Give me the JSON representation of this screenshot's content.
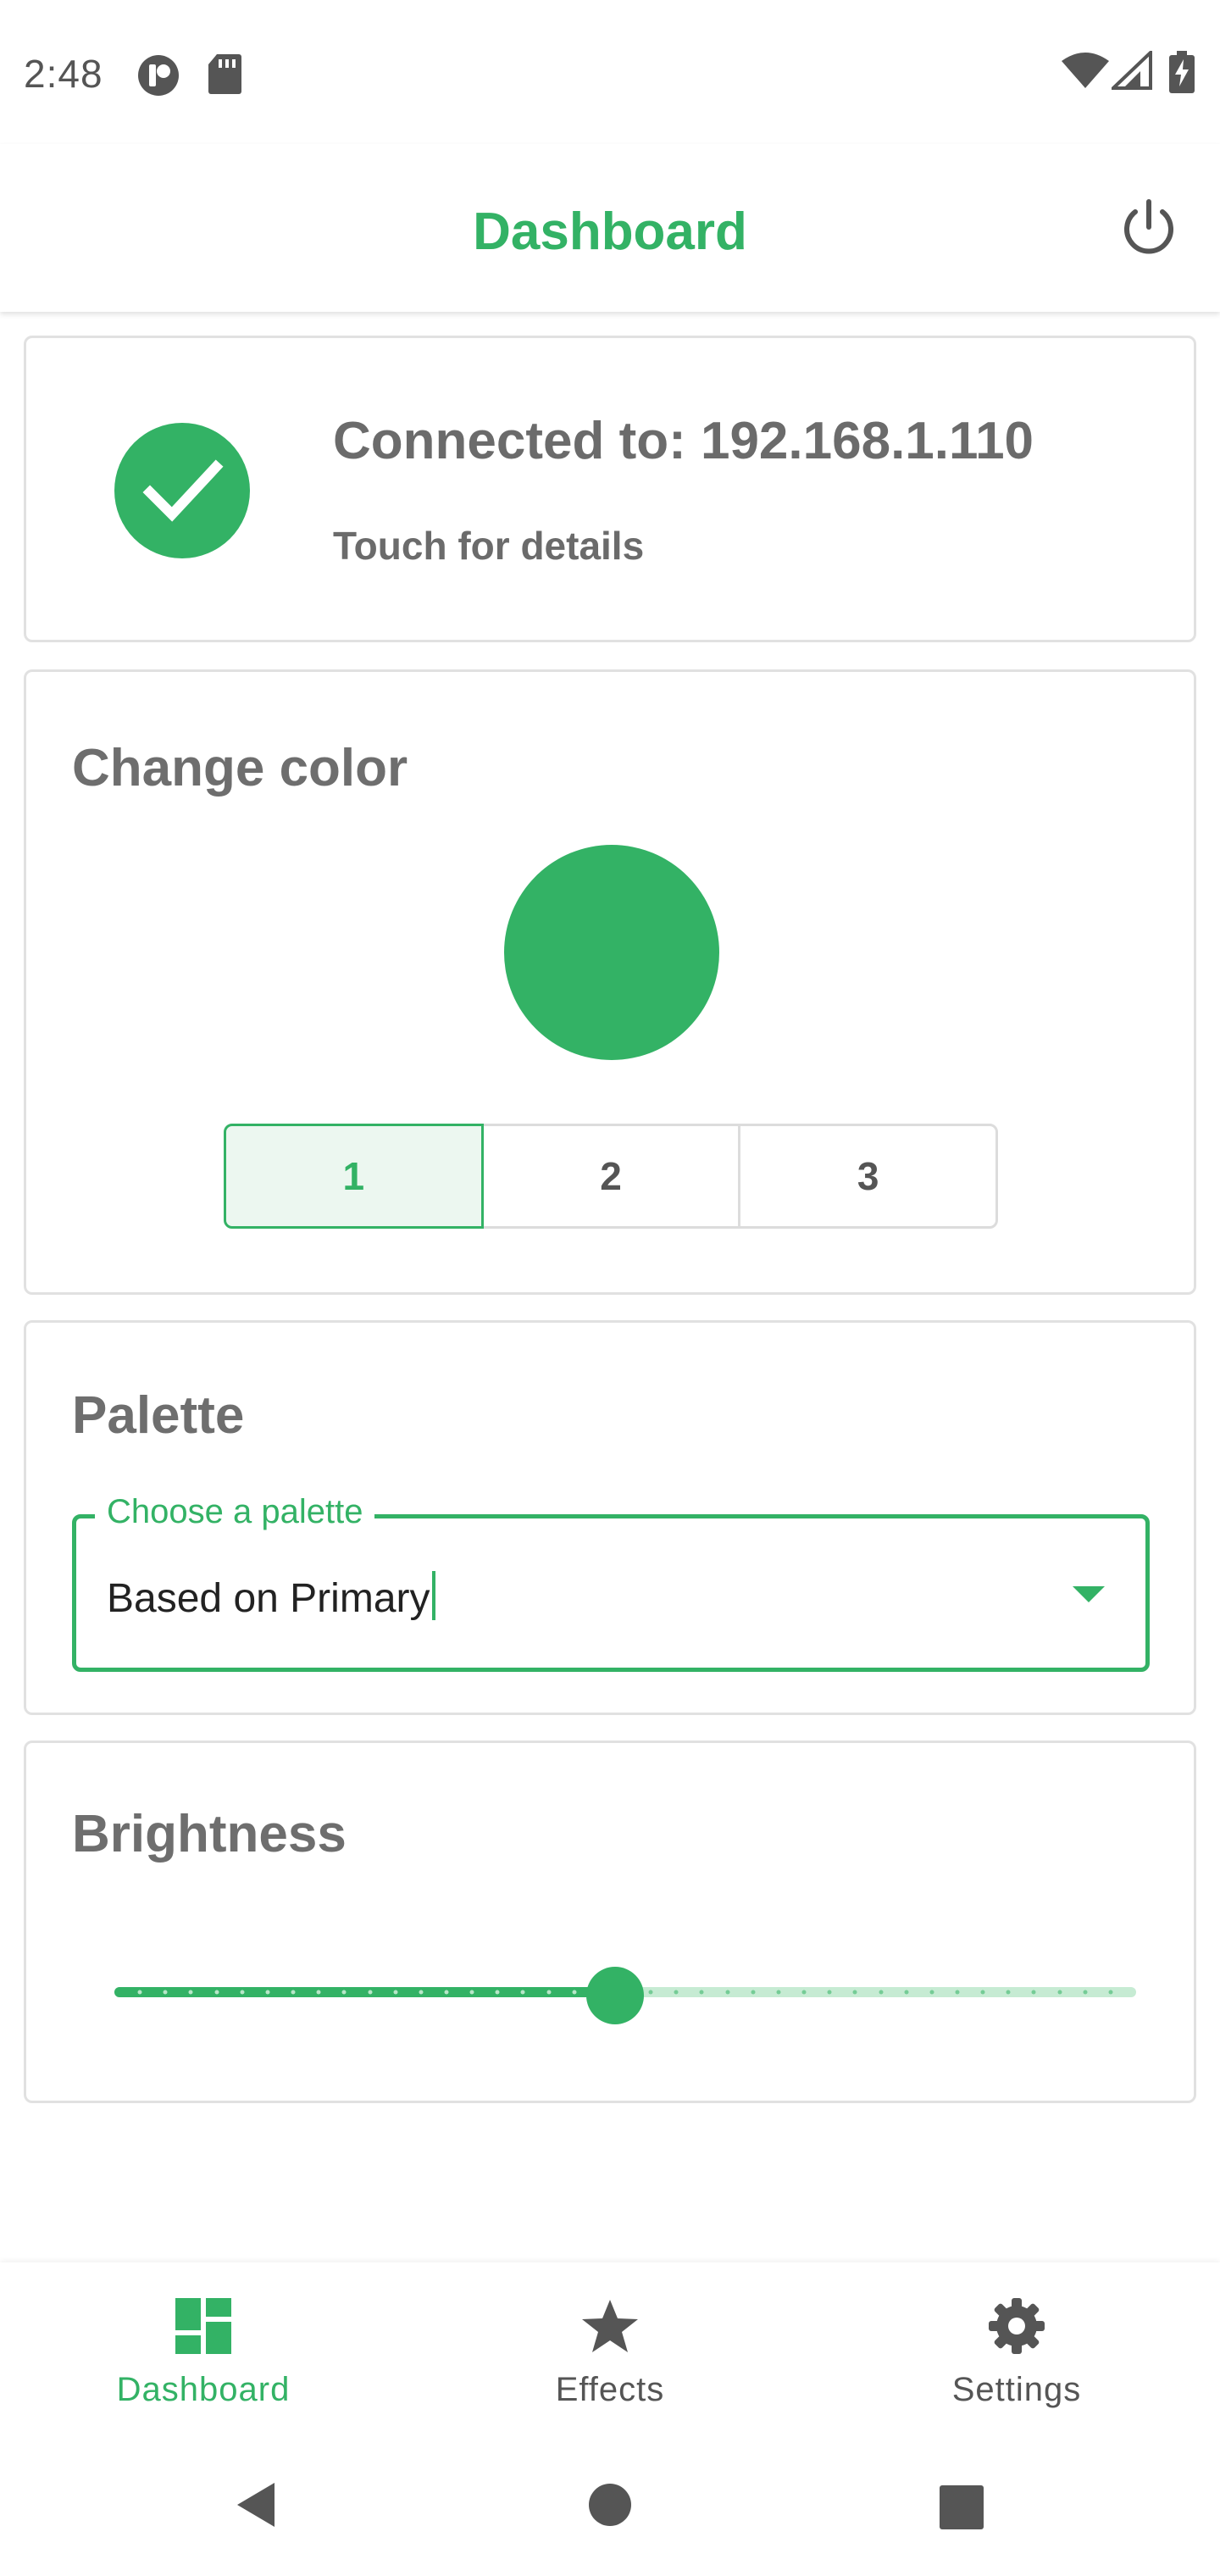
{
  "status_bar": {
    "time": "2:48",
    "left_icons": [
      "app-notification-icon",
      "sd-card-icon"
    ],
    "right_icons": [
      "wifi-icon",
      "cell-signal-icon",
      "battery-charging-icon"
    ]
  },
  "app_bar": {
    "title": "Dashboard",
    "action_icon": "power-icon"
  },
  "connection": {
    "title": "Connected to: 192.168.1.110",
    "subtitle": "Touch for details",
    "status_icon": "check-circle-icon"
  },
  "color_card": {
    "title": "Change color",
    "current_color": "#33b265",
    "segments": [
      "1",
      "2",
      "3"
    ],
    "selected_segment": 0
  },
  "palette_card": {
    "title": "Palette",
    "field_label": "Choose a palette",
    "field_value": "Based on Primary"
  },
  "brightness_card": {
    "title": "Brightness",
    "value_fraction": 0.49
  },
  "bottom_nav": {
    "items": [
      {
        "label": "Dashboard",
        "icon": "dashboard-icon",
        "active": true
      },
      {
        "label": "Effects",
        "icon": "star-icon",
        "active": false
      },
      {
        "label": "Settings",
        "icon": "gear-icon",
        "active": false
      }
    ]
  },
  "colors": {
    "accent": "#33b265",
    "accent_light": "#c6ebd3",
    "text_secondary": "#6b6b6b"
  }
}
